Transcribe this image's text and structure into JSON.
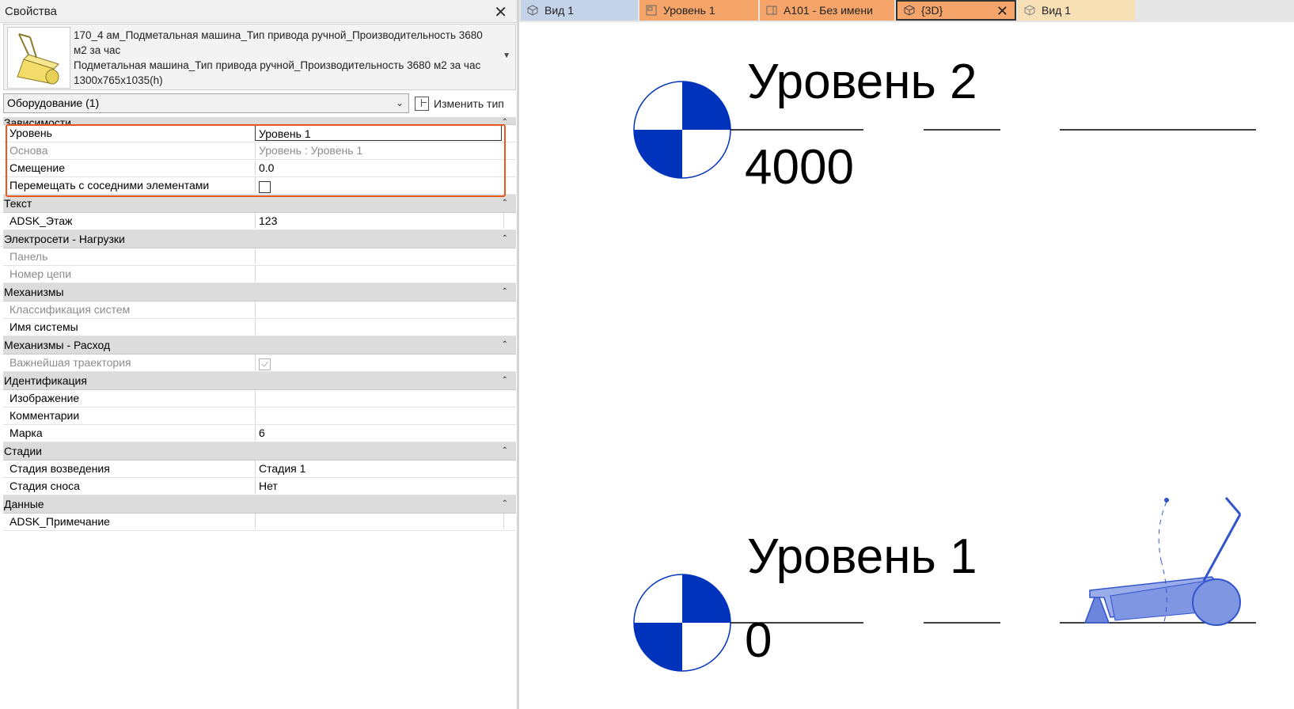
{
  "properties": {
    "title": "Свойства",
    "type_line1": "170_4 ам_Подметальная машина_Тип привода ручной_Производительность 3680 м2 за час",
    "type_line2": "Подметальная машина_Тип привода ручной_Производительность 3680 м2 за час 1300x765x1035(h)",
    "filter": "Оборудование (1)",
    "edit_type": "Изменить тип",
    "sections": {
      "constraints": "Зависимости",
      "text": "Текст",
      "electrical": "Электросети - Нагрузки",
      "mechanical": "Механизмы",
      "mechanical_flow": "Механизмы - Расход",
      "identity": "Идентификация",
      "phasing": "Стадии",
      "data": "Данные"
    },
    "rows": {
      "level": {
        "label": "Уровень",
        "value": "Уровень 1"
      },
      "host": {
        "label": "Основа",
        "value": "Уровень : Уровень 1"
      },
      "offset": {
        "label": "Смещение",
        "value": "0.0"
      },
      "moves": {
        "label": "Перемещать с соседними элементами",
        "value": ""
      },
      "floor": {
        "label": "ADSK_Этаж",
        "value": "123"
      },
      "panel": {
        "label": "Панель",
        "value": ""
      },
      "circuit": {
        "label": "Номер цепи",
        "value": ""
      },
      "sys_class": {
        "label": "Классификация систем",
        "value": ""
      },
      "sys_name": {
        "label": "Имя системы",
        "value": ""
      },
      "crit_path": {
        "label": "Важнейшая траектория",
        "value": ""
      },
      "image": {
        "label": "Изображение",
        "value": ""
      },
      "comments": {
        "label": "Комментарии",
        "value": ""
      },
      "mark": {
        "label": "Марка",
        "value": "6"
      },
      "phase_created": {
        "label": "Стадия возведения",
        "value": "Стадия 1"
      },
      "phase_demolished": {
        "label": "Стадия сноса",
        "value": "Нет"
      },
      "note": {
        "label": "ADSK_Примечание",
        "value": ""
      }
    }
  },
  "tabs": [
    {
      "label": "Вид 1"
    },
    {
      "label": "Уровень 1"
    },
    {
      "label": "A101 - Без имени"
    },
    {
      "label": "{3D}"
    },
    {
      "label": "Вид 1"
    }
  ],
  "levels": {
    "top": {
      "name": "Уровень 2",
      "elevation": "4000"
    },
    "bottom": {
      "name": "Уровень 1",
      "elevation": "0"
    }
  },
  "colors": {
    "highlight": "#e8581c",
    "level_marker": "#0033bb",
    "machine": "#3355cc",
    "tab_blue": "#c5d3e8",
    "tab_orange": "#f5a56a",
    "tab_active_border": "#333333"
  }
}
